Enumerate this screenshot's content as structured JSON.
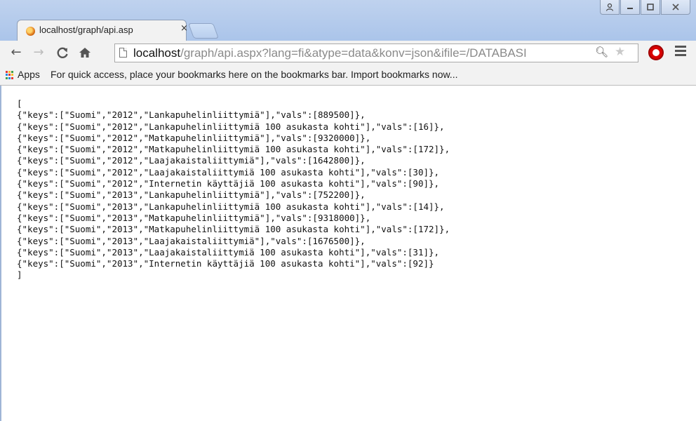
{
  "window": {
    "controls": [
      "user",
      "minimize",
      "maximize",
      "close"
    ]
  },
  "tab": {
    "title": "localhost/graph/api.asp",
    "favicon": "chromium-favicon-icon",
    "close_label": "×"
  },
  "toolbar": {
    "back_icon": "back-arrow-icon",
    "forward_icon": "forward-arrow-icon",
    "reload_icon": "reload-icon",
    "home_icon": "home-icon",
    "url_host": "localhost",
    "url_path": "/graph/api.aspx?lang=fi&atype=data&konv=json&ifile=/DATABASI",
    "zoom_icon": "zoom-icon",
    "star_icon": "bookmark-star-icon",
    "extension_icon": "adblock-icon",
    "menu_icon": "menu-icon"
  },
  "bookmarks_bar": {
    "apps_label": "Apps",
    "hint_text": "For quick access, place your bookmarks here on the bookmarks bar. Import bookmarks now..."
  },
  "content": {
    "lines": [
      "[",
      "{\"keys\":[\"Suomi\",\"2012\",\"Lankapuhelinliittymiä\"],\"vals\":[889500]},",
      "{\"keys\":[\"Suomi\",\"2012\",\"Lankapuhelinliittymiä 100 asukasta kohti\"],\"vals\":[16]},",
      "{\"keys\":[\"Suomi\",\"2012\",\"Matkapuhelinliittymiä\"],\"vals\":[9320000]},",
      "{\"keys\":[\"Suomi\",\"2012\",\"Matkapuhelinliittymiä 100 asukasta kohti\"],\"vals\":[172]},",
      "{\"keys\":[\"Suomi\",\"2012\",\"Laajakaistaliittymiä\"],\"vals\":[1642800]},",
      "{\"keys\":[\"Suomi\",\"2012\",\"Laajakaistaliittymiä 100 asukasta kohti\"],\"vals\":[30]},",
      "{\"keys\":[\"Suomi\",\"2012\",\"Internetin käyttäjiä 100 asukasta kohti\"],\"vals\":[90]},",
      "{\"keys\":[\"Suomi\",\"2013\",\"Lankapuhelinliittymiä\"],\"vals\":[752200]},",
      "{\"keys\":[\"Suomi\",\"2013\",\"Lankapuhelinliittymiä 100 asukasta kohti\"],\"vals\":[14]},",
      "{\"keys\":[\"Suomi\",\"2013\",\"Matkapuhelinliittymiä\"],\"vals\":[9318000]},",
      "{\"keys\":[\"Suomi\",\"2013\",\"Matkapuhelinliittymiä 100 asukasta kohti\"],\"vals\":[172]},",
      "{\"keys\":[\"Suomi\",\"2013\",\"Laajakaistaliittymiä\"],\"vals\":[1676500]},",
      "{\"keys\":[\"Suomi\",\"2013\",\"Laajakaistaliittymiä 100 asukasta kohti\"],\"vals\":[31]},",
      "{\"keys\":[\"Suomi\",\"2013\",\"Internetin käyttäjiä 100 asukasta kohti\"],\"vals\":[92]}",
      "]"
    ]
  }
}
